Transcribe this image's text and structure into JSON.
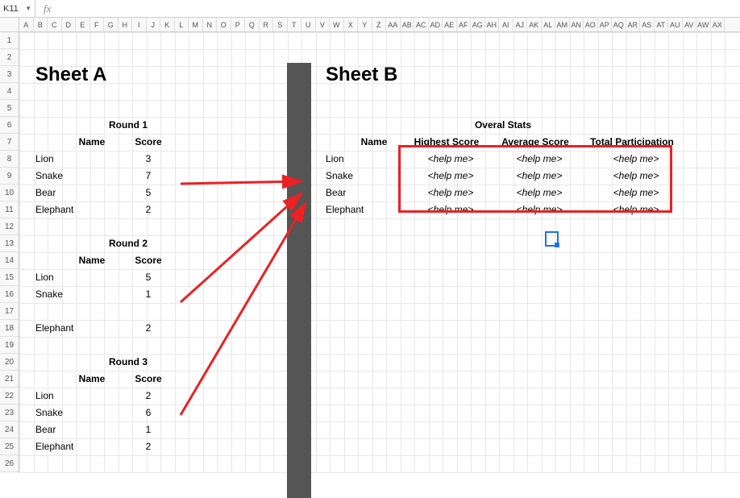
{
  "nameBox": "K11",
  "fxLabel": "fx",
  "colLetters": [
    "A",
    "B",
    "C",
    "D",
    "E",
    "F",
    "G",
    "H",
    "I",
    "J",
    "K",
    "L",
    "M",
    "N",
    "O",
    "P",
    "Q",
    "R",
    "S",
    "T",
    "U",
    "V",
    "W",
    "X",
    "Y",
    "Z",
    "AA",
    "AB",
    "AC",
    "AD",
    "AE",
    "AF",
    "AG",
    "AH",
    "AI",
    "AJ",
    "AK",
    "AL",
    "AM",
    "AN",
    "AO",
    "AP",
    "AQ",
    "AR",
    "AS",
    "AT",
    "AU",
    "AV",
    "AW",
    "AX"
  ],
  "rowNums": [
    "1",
    "2",
    "3",
    "4",
    "5",
    "6",
    "7",
    "8",
    "9",
    "10",
    "11",
    "12",
    "13",
    "14",
    "15",
    "16",
    "17",
    "18",
    "19",
    "20",
    "21",
    "22",
    "23",
    "24",
    "25",
    "26"
  ],
  "sheetA": {
    "title": "Sheet A",
    "rounds": [
      {
        "label": "Round 1",
        "headers": {
          "name": "Name",
          "score": "Score"
        },
        "rows": [
          {
            "name": "Lion",
            "score": "3"
          },
          {
            "name": "Snake",
            "score": "7"
          },
          {
            "name": "Bear",
            "score": "5"
          },
          {
            "name": "Elephant",
            "score": "2"
          }
        ]
      },
      {
        "label": "Round 2",
        "headers": {
          "name": "Name",
          "score": "Score"
        },
        "rows": [
          {
            "name": "Lion",
            "score": "5"
          },
          {
            "name": "Snake",
            "score": "1"
          },
          {
            "name": "",
            "score": ""
          },
          {
            "name": "Elephant",
            "score": "2"
          }
        ]
      },
      {
        "label": "Round 3",
        "headers": {
          "name": "Name",
          "score": "Score"
        },
        "rows": [
          {
            "name": "Lion",
            "score": "2"
          },
          {
            "name": "Snake",
            "score": "6"
          },
          {
            "name": "Bear",
            "score": "1"
          },
          {
            "name": "Elephant",
            "score": "2"
          }
        ]
      }
    ]
  },
  "sheetB": {
    "title": "Sheet B",
    "overall": "Overal Stats",
    "headers": {
      "name": "Name",
      "high": "Highest Score",
      "avg": "Average Score",
      "tot": "Total Participation"
    },
    "placeholder": "<help me>",
    "rows": [
      {
        "name": "Lion"
      },
      {
        "name": "Snake"
      },
      {
        "name": "Bear"
      },
      {
        "name": "Elephant"
      }
    ]
  }
}
